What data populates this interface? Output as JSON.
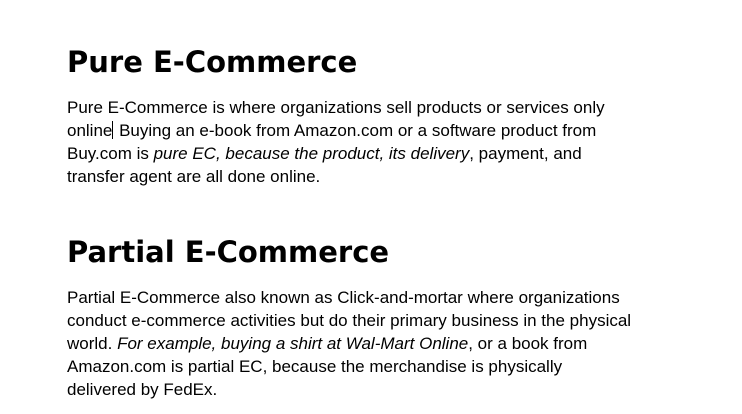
{
  "section1": {
    "heading": "Pure E-Commerce",
    "line1": "Pure E-Commerce is where organizations sell products or services only",
    "line2_a": "online",
    "line2_b": " Buying an e-book from Amazon.com or a software product from",
    "line3_a": "Buy.com is ",
    "line3_italic": "pure EC, because the product, its delivery",
    "line3_b": ", payment, and",
    "line4": "transfer agent are all done online."
  },
  "section2": {
    "heading": "Partial E-Commerce",
    "line1": "Partial E-Commerce also known as Click-and-mortar where organizations",
    "line2": "conduct e-commerce activities but do their primary business in the physical",
    "line3_a": "world. ",
    "line3_italic": "For example, buying a shirt at Wal-Mart Online",
    "line3_b": ", or a book from",
    "line4": "Amazon.com is partial EC, because the merchandise is physically",
    "line5": "delivered by FedEx."
  }
}
